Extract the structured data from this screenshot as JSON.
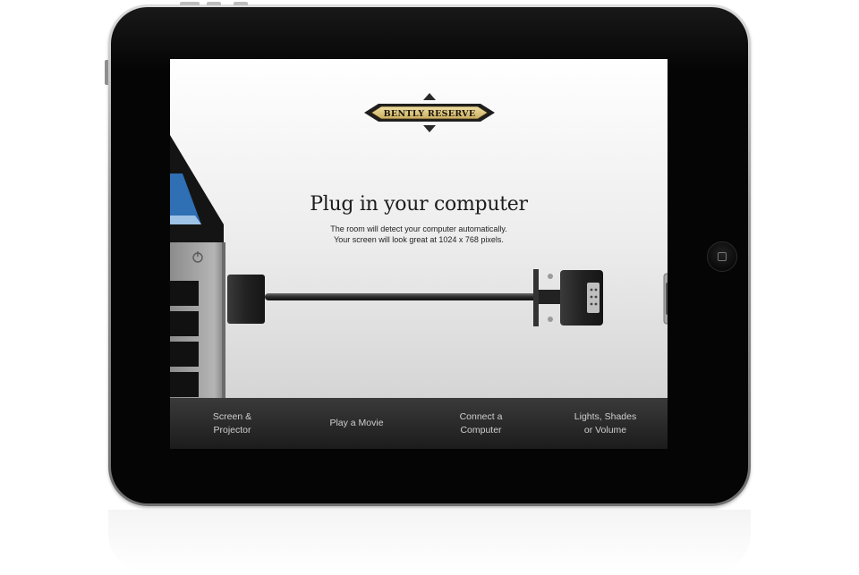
{
  "logo": {
    "text": "BENTLY RESERVE"
  },
  "main": {
    "headline": "Plug in your computer",
    "subtext_line1": "The room will detect your computer automatically.",
    "subtext_line2": "Your screen will look great at 1024 x 768 pixels."
  },
  "nav": {
    "items": [
      {
        "label": "Screen &\nProjector"
      },
      {
        "label": "Play a Movie"
      },
      {
        "label": "Connect a\nComputer"
      },
      {
        "label": "Lights, Shades\nor Volume"
      }
    ]
  },
  "icons": {
    "power": "power-icon",
    "home": "home-button-icon"
  },
  "colors": {
    "screen_background": "#ececec",
    "nav_bar": "#2a2a2a",
    "nav_text": "#cfcfcf",
    "logo_gold": "#d9c27a",
    "bezel": "#050505"
  }
}
